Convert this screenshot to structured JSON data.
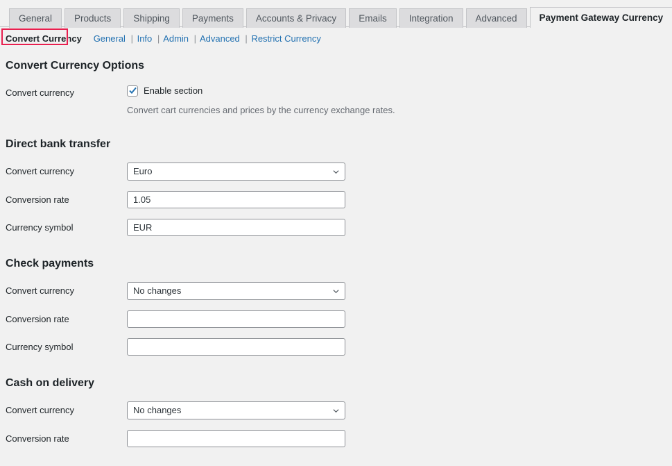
{
  "tabs": [
    {
      "label": "General",
      "active": false
    },
    {
      "label": "Products",
      "active": false
    },
    {
      "label": "Shipping",
      "active": false
    },
    {
      "label": "Payments",
      "active": false
    },
    {
      "label": "Accounts & Privacy",
      "active": false
    },
    {
      "label": "Emails",
      "active": false
    },
    {
      "label": "Integration",
      "active": false
    },
    {
      "label": "Advanced",
      "active": false
    },
    {
      "label": "Payment Gateway Currency",
      "active": true
    }
  ],
  "subnav": {
    "current": "Convert Currency",
    "links": [
      "General",
      "Info",
      "Admin",
      "Advanced",
      "Restrict Currency"
    ],
    "separator": "|",
    "highlight_color": "#e8204f"
  },
  "section": {
    "title": "Convert Currency Options",
    "enable": {
      "label": "Convert currency",
      "checkbox_label": "Enable section",
      "checked": true,
      "description": "Convert cart currencies and prices by the currency exchange rates."
    }
  },
  "labels": {
    "convert_currency": "Convert currency",
    "conversion_rate": "Conversion rate",
    "currency_symbol": "Currency symbol"
  },
  "gateways": [
    {
      "title": "Direct bank transfer",
      "currency": "Euro",
      "rate": "1.05",
      "symbol": "EUR"
    },
    {
      "title": "Check payments",
      "currency": "No changes",
      "rate": "",
      "symbol": ""
    },
    {
      "title": "Cash on delivery",
      "currency": "No changes",
      "rate": "",
      "symbol": ""
    }
  ],
  "colors": {
    "page_background": "#f1f1f1",
    "tab_inactive": "#dcdcde",
    "link": "#2271b1",
    "text": "#1d2327",
    "muted": "#646970",
    "border": "#8c8f94"
  }
}
